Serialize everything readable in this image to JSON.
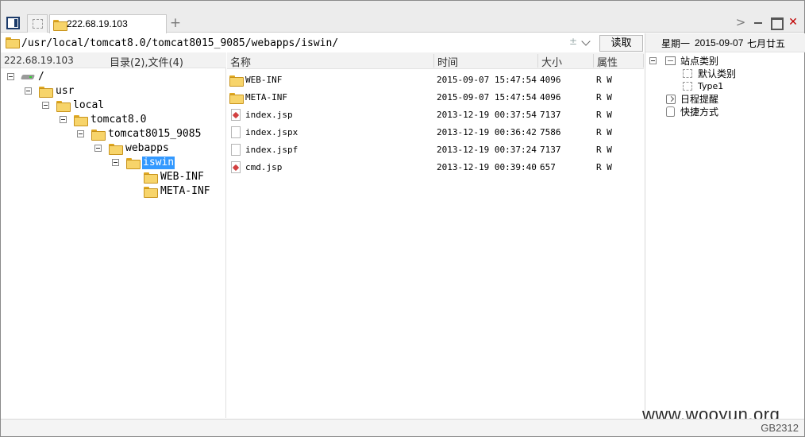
{
  "tabs": {
    "active_label": "222.68.19.103",
    "new_tab_symbol": "+",
    "scroll_symbol": ">",
    "close_symbol": "✕"
  },
  "address": {
    "path": "/usr/local/tomcat8.0/tomcat8015_9085/webapps/iswin/",
    "encoding_symbol": "±",
    "read_label": "读取"
  },
  "tree": {
    "host": "222.68.19.103",
    "summary": "目录(2),文件(4)",
    "nodes": [
      {
        "label": "/"
      },
      {
        "label": "usr"
      },
      {
        "label": "local"
      },
      {
        "label": "tomcat8.0"
      },
      {
        "label": "tomcat8015_9085"
      },
      {
        "label": "webapps"
      },
      {
        "label": "iswin",
        "selected": true
      },
      {
        "label": "WEB-INF"
      },
      {
        "label": "META-INF"
      }
    ]
  },
  "files": {
    "columns": [
      "名称",
      "时间",
      "大小",
      "属性"
    ],
    "rows": [
      {
        "name": "WEB-INF",
        "time": "2015-09-07 15:47:54",
        "size": "4096",
        "attr": "R W",
        "kind": "folder"
      },
      {
        "name": "META-INF",
        "time": "2015-09-07 15:47:54",
        "size": "4096",
        "attr": "R W",
        "kind": "folder"
      },
      {
        "name": "index.jsp",
        "time": "2013-12-19 00:37:54",
        "size": "7137",
        "attr": "R W",
        "kind": "jsp"
      },
      {
        "name": "index.jspx",
        "time": "2013-12-19 00:36:42",
        "size": "7586",
        "attr": "R W",
        "kind": "file"
      },
      {
        "name": "index.jspf",
        "time": "2013-12-19 00:37:24",
        "size": "7137",
        "attr": "R W",
        "kind": "file"
      },
      {
        "name": "cmd.jsp",
        "time": "2013-12-19 00:39:40",
        "size": "657",
        "attr": "R W",
        "kind": "jsp"
      }
    ]
  },
  "right_panel": {
    "weekday": "星期一",
    "date": "2015-09-07",
    "lunar": "七月廿五",
    "site_category": "站点类别",
    "default_category": "默认类别",
    "type1": "Type1",
    "schedule": "日程提醒",
    "shortcuts": "快捷方式"
  },
  "watermark": "www.wooyun.org",
  "status": {
    "encoding": "GB2312"
  }
}
